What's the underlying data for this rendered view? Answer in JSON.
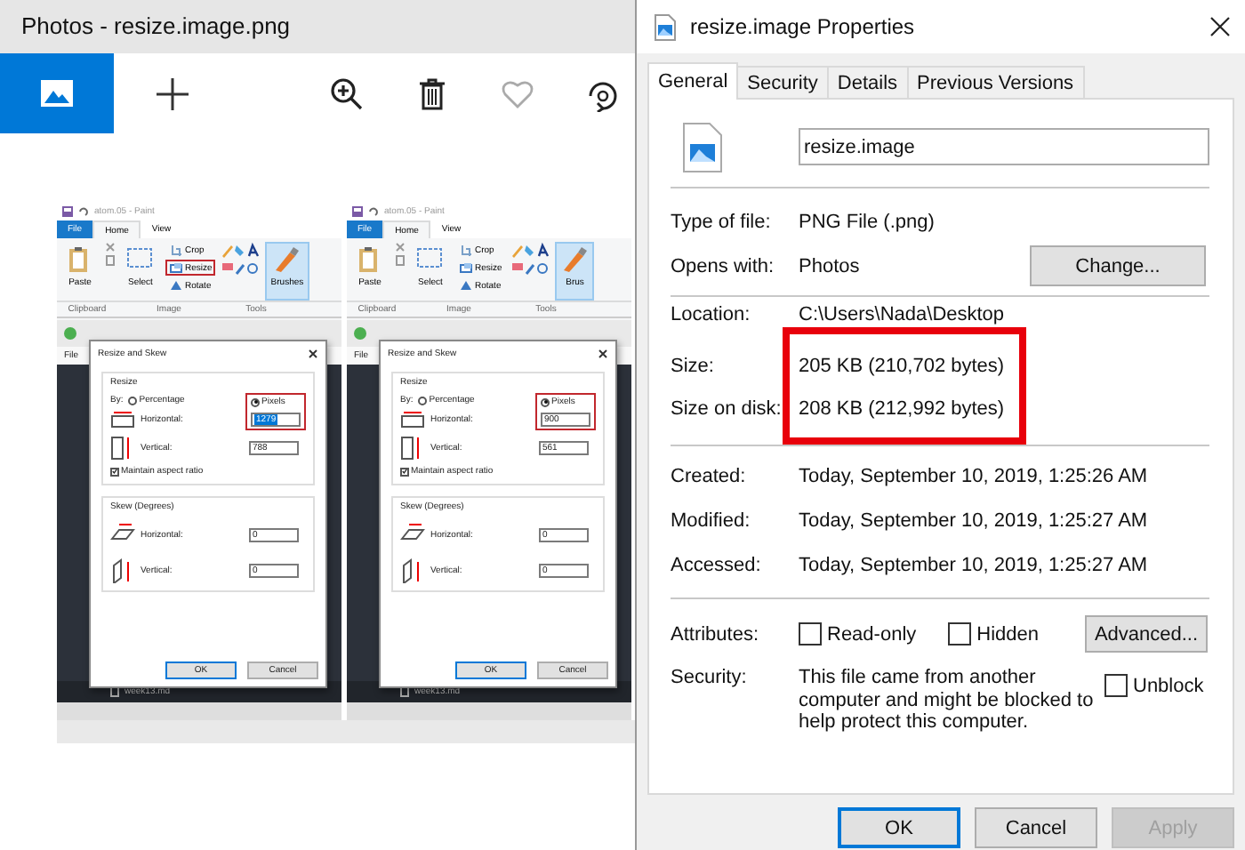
{
  "photos": {
    "title": "Photos - resize.image.png",
    "toolbar": [
      {
        "kind": "image",
        "selected": true
      },
      {
        "kind": "add",
        "selected": false
      },
      {
        "kind": "zoom",
        "selected": false
      },
      {
        "kind": "delete",
        "selected": false
      },
      {
        "kind": "favorite",
        "selected": false
      },
      {
        "kind": "rotate",
        "selected": false
      }
    ],
    "screenshots": [
      {
        "app_title": "atom.05 - Paint",
        "tabs": [
          {
            "label": "File",
            "kind": "file",
            "selected": false
          },
          {
            "label": "Home",
            "kind": "tab",
            "selected": true
          },
          {
            "label": "View",
            "kind": "tab",
            "selected": false
          }
        ],
        "tools": [
          {
            "label": "Paste",
            "kind": "paste",
            "highlighted": false
          },
          {
            "label": "Select",
            "kind": "select",
            "highlighted": false
          },
          {
            "label": "Crop",
            "kind": "crop",
            "highlighted": false
          },
          {
            "label": "Resize",
            "kind": "resize",
            "highlighted": true
          },
          {
            "label": "Rotate",
            "kind": "rotate",
            "highlighted": false
          },
          {
            "label": "Brushes",
            "kind": "brushes",
            "highlighted": false
          }
        ],
        "groups": [
          "Clipboard",
          "Image",
          "Tools"
        ],
        "editor_menu": "File",
        "file_tab": "week13.md",
        "dialog": {
          "title": "Resize and Skew",
          "resize_heading": "Resize",
          "by_label": "By:",
          "options": [
            {
              "label": "Percentage",
              "selected": false
            },
            {
              "label": "Pixels",
              "selected": true
            }
          ],
          "pixels_highlighted": true,
          "horizontal_label": "Horizontal:",
          "horizontal_value": "1279",
          "value_selected": true,
          "vertical_label": "Vertical:",
          "vertical_value": "788",
          "aspect": {
            "label": "Maintain aspect ratio",
            "checked": true
          },
          "skew_heading": "Skew (Degrees)",
          "skew_fields": [
            {
              "label": "Horizontal:",
              "value": "0"
            },
            {
              "label": "Vertical:",
              "value": "0"
            }
          ],
          "buttons": [
            "OK",
            "Cancel"
          ]
        }
      },
      {
        "app_title": "atom.05 - Paint",
        "tabs": [
          {
            "label": "File",
            "kind": "file",
            "selected": false
          },
          {
            "label": "Home",
            "kind": "tab",
            "selected": true
          },
          {
            "label": "View",
            "kind": "tab",
            "selected": false
          }
        ],
        "tools": [
          {
            "label": "Paste",
            "kind": "paste",
            "highlighted": false
          },
          {
            "label": "Select",
            "kind": "select",
            "highlighted": false
          },
          {
            "label": "Crop",
            "kind": "crop",
            "highlighted": false
          },
          {
            "label": "Resize",
            "kind": "resize",
            "highlighted": false
          },
          {
            "label": "Rotate",
            "kind": "rotate",
            "highlighted": false
          },
          {
            "label": "Brus",
            "kind": "brushes",
            "highlighted": false
          }
        ],
        "groups": [
          "Clipboard",
          "Image",
          "Tools"
        ],
        "editor_menu": "File",
        "file_tab": "week13.md",
        "dialog": {
          "title": "Resize and Skew",
          "resize_heading": "Resize",
          "by_label": "By:",
          "options": [
            {
              "label": "Percentage",
              "selected": false
            },
            {
              "label": "Pixels",
              "selected": true
            }
          ],
          "pixels_highlighted": true,
          "horizontal_label": "Horizontal:",
          "horizontal_value": "900",
          "value_selected": false,
          "vertical_label": "Vertical:",
          "vertical_value": "561",
          "aspect": {
            "label": "Maintain aspect ratio",
            "checked": true
          },
          "skew_heading": "Skew (Degrees)",
          "skew_fields": [
            {
              "label": "Horizontal:",
              "value": "0"
            },
            {
              "label": "Vertical:",
              "value": "0"
            }
          ],
          "buttons": [
            "OK",
            "Cancel"
          ]
        }
      }
    ]
  },
  "properties": {
    "title": "resize.image Properties",
    "tabs": [
      {
        "label": "General",
        "selected": true
      },
      {
        "label": "Security",
        "selected": false
      },
      {
        "label": "Details",
        "selected": false
      },
      {
        "label": "Previous Versions",
        "selected": false
      }
    ],
    "file_name": "resize.image",
    "type": {
      "label": "Type of file:",
      "value": "PNG File (.png)"
    },
    "opens_with": {
      "label": "Opens with:",
      "value": "Photos",
      "button": "Change..."
    },
    "location": {
      "label": "Location:",
      "value": "C:\\Users\\Nada\\Desktop"
    },
    "sizes_highlighted": true,
    "sizes": [
      {
        "label": "Size:",
        "value": "205 KB (210,702 bytes)"
      },
      {
        "label": "Size on disk:",
        "value": "208 KB (212,992 bytes)"
      }
    ],
    "dates": [
      {
        "label": "Created:",
        "value": "Today, September 10, 2019, 1:25:26 AM"
      },
      {
        "label": "Modified:",
        "value": "Today, September 10, 2019, 1:25:27 AM"
      },
      {
        "label": "Accessed:",
        "value": "Today, September 10, 2019, 1:25:27 AM"
      }
    ],
    "attributes": {
      "label": "Attributes:",
      "checkboxes": [
        {
          "label": "Read-only",
          "checked": false
        },
        {
          "label": "Hidden",
          "checked": false
        }
      ],
      "button": "Advanced..."
    },
    "security": {
      "label": "Security:",
      "text": "This file came from another computer and might be blocked to help protect this computer.",
      "unblock": {
        "label": "Unblock",
        "checked": false
      }
    },
    "buttons": [
      {
        "label": "OK",
        "default": true,
        "disabled": false
      },
      {
        "label": "Cancel",
        "default": false,
        "disabled": false
      },
      {
        "label": "Apply",
        "default": false,
        "disabled": true
      }
    ]
  }
}
